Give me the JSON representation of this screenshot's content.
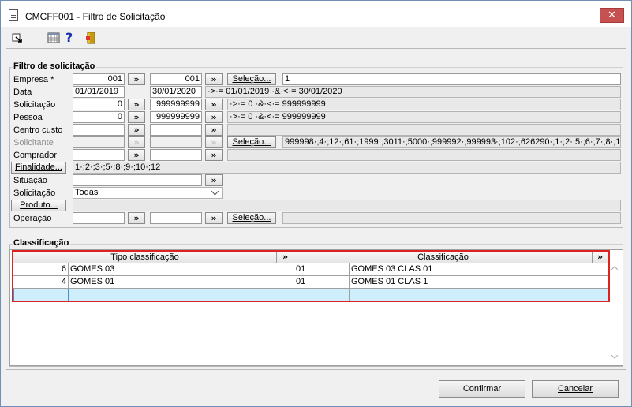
{
  "window": {
    "title": "CMCFF001 - Filtro de Solicitação",
    "close_glyph": "✕"
  },
  "toolbar": {
    "help_glyph": "?"
  },
  "filtro": {
    "legend": "Filtro de solicitação",
    "empresa": {
      "label": "Empresa *",
      "from": "001",
      "to": "001",
      "sel": "Seleção...",
      "summary": "1"
    },
    "data": {
      "label": "Data",
      "from": "01/01/2019",
      "to": "30/01/2020",
      "summary": "·>·= 01/01/2019 ·&·<·= 30/01/2020"
    },
    "solicitacao": {
      "label": "Solicitação",
      "from": "0",
      "to": "999999999",
      "summary": "·>·= 0 ·&·<·= 999999999"
    },
    "pessoa": {
      "label": "Pessoa",
      "from": "0",
      "to": "999999999",
      "summary": "·>·= 0 ·&·<·= 999999999"
    },
    "centro": {
      "label": "Centro custo"
    },
    "solicitante": {
      "label": "Solicitante",
      "sel": "Seleção...",
      "summary": "999998·;4·;12·;61·;1999·;3011·;5000·;999992·;999993·;102·;626290·;1·;2·;5·;6·;7·;8·;1"
    },
    "comprador": {
      "label": "Comprador"
    },
    "finalidade": {
      "btn": "Finalidade...",
      "summary": "1·;2·;3·;5·;8·;9·;10·;12"
    },
    "situacao": {
      "label": "Situação"
    },
    "solicitacao2": {
      "label": "Solicitação",
      "value": "Todas"
    },
    "produto": {
      "btn": "Produto..."
    },
    "operacao": {
      "label": "Operação",
      "sel": "Seleção..."
    },
    "arrow": "»"
  },
  "classificacao": {
    "legend": "Classificação",
    "col_tipo": "Tipo classificação",
    "col_class": "Classificação",
    "rows": [
      {
        "tipo_id": "6",
        "tipo": "GOMES 03",
        "cls_id": "01",
        "cls": "GOMES 03 CLAS 01"
      },
      {
        "tipo_id": "4",
        "tipo": "GOMES 01",
        "cls_id": "01",
        "cls": "GOMES 01 CLAS 1"
      }
    ]
  },
  "footer": {
    "confirm": "Confirmar",
    "cancel": "Cancelar"
  }
}
